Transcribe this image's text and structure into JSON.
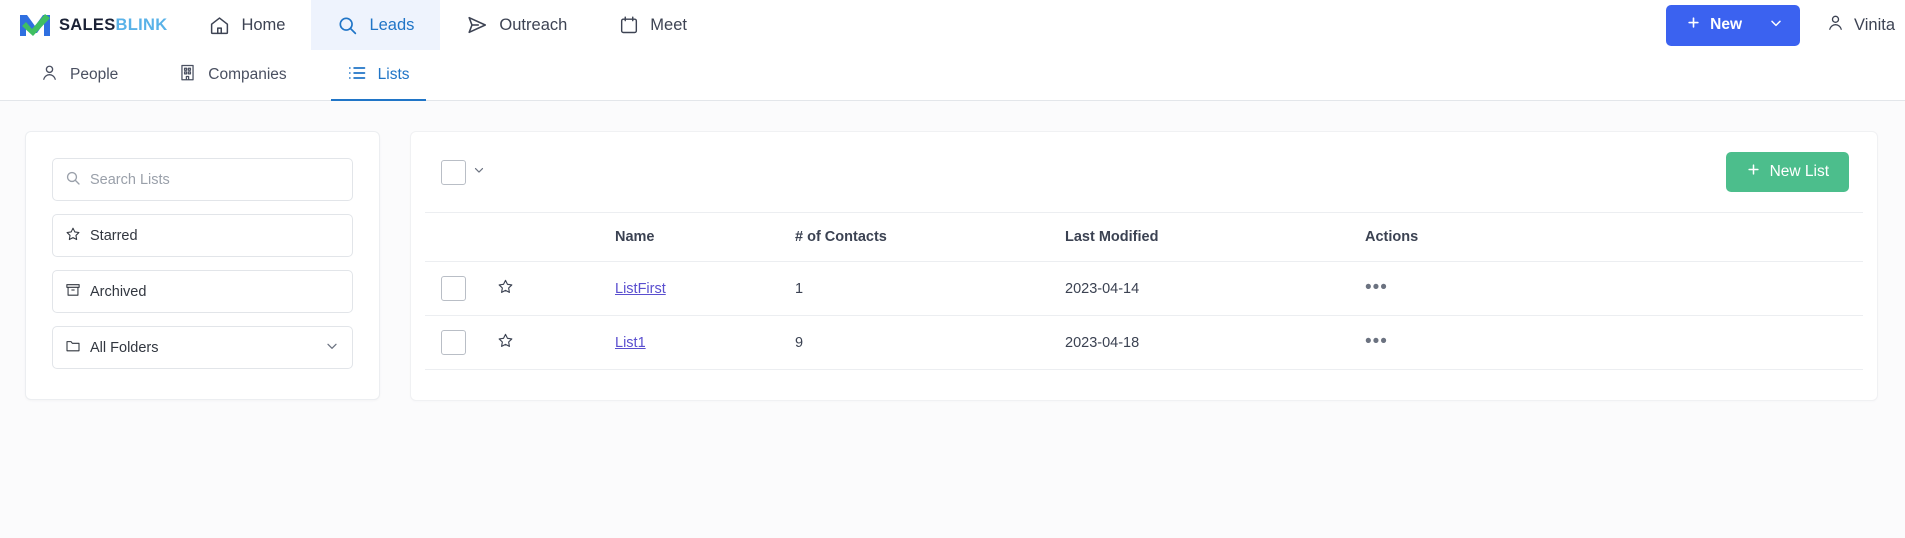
{
  "brand": {
    "name_part1": "SALES",
    "name_part2": "BLINK",
    "logo_icon": "salesblink-logo-icon"
  },
  "topnav": {
    "items": [
      {
        "label": "Home",
        "icon": "home-icon",
        "active": false
      },
      {
        "label": "Leads",
        "icon": "search-icon",
        "active": true
      },
      {
        "label": "Outreach",
        "icon": "send-icon",
        "active": false
      },
      {
        "label": "Meet",
        "icon": "calendar-icon",
        "active": false
      }
    ],
    "new_button": {
      "label": "New",
      "plus_icon": "plus-icon",
      "caret_icon": "chevron-down-icon",
      "color": "#3b62f0"
    },
    "user": {
      "name": "Vinita",
      "icon": "user-icon"
    }
  },
  "subnav": {
    "items": [
      {
        "label": "People",
        "icon": "person-icon",
        "active": false
      },
      {
        "label": "Companies",
        "icon": "building-icon",
        "active": false
      },
      {
        "label": "Lists",
        "icon": "list-icon",
        "active": true
      }
    ],
    "active_color": "#2075c7"
  },
  "sidebar": {
    "search": {
      "placeholder": "Search Lists",
      "value": "",
      "icon": "search-icon"
    },
    "items": [
      {
        "label": "Starred",
        "icon": "star-icon",
        "caret": false
      },
      {
        "label": "Archived",
        "icon": "archive-icon",
        "caret": false
      },
      {
        "label": "All Folders",
        "icon": "folder-icon",
        "caret": true
      }
    ]
  },
  "main": {
    "select_all": {
      "checked": false,
      "caret_icon": "chevron-down-icon"
    },
    "new_list_button": {
      "label": "New List",
      "plus_icon": "plus-icon",
      "color": "#4cbe8c"
    },
    "table": {
      "columns": [
        "",
        "",
        "Name",
        "# of Contacts",
        "Last Modified",
        "Actions"
      ],
      "rows": [
        {
          "checked": false,
          "starred": false,
          "name": "ListFirst",
          "contacts": "1",
          "last_modified": "2023-04-14",
          "actions_icon": "ellipsis-icon"
        },
        {
          "checked": false,
          "starred": false,
          "name": "List1",
          "contacts": "9",
          "last_modified": "2023-04-18",
          "actions_icon": "ellipsis-icon"
        }
      ]
    }
  }
}
